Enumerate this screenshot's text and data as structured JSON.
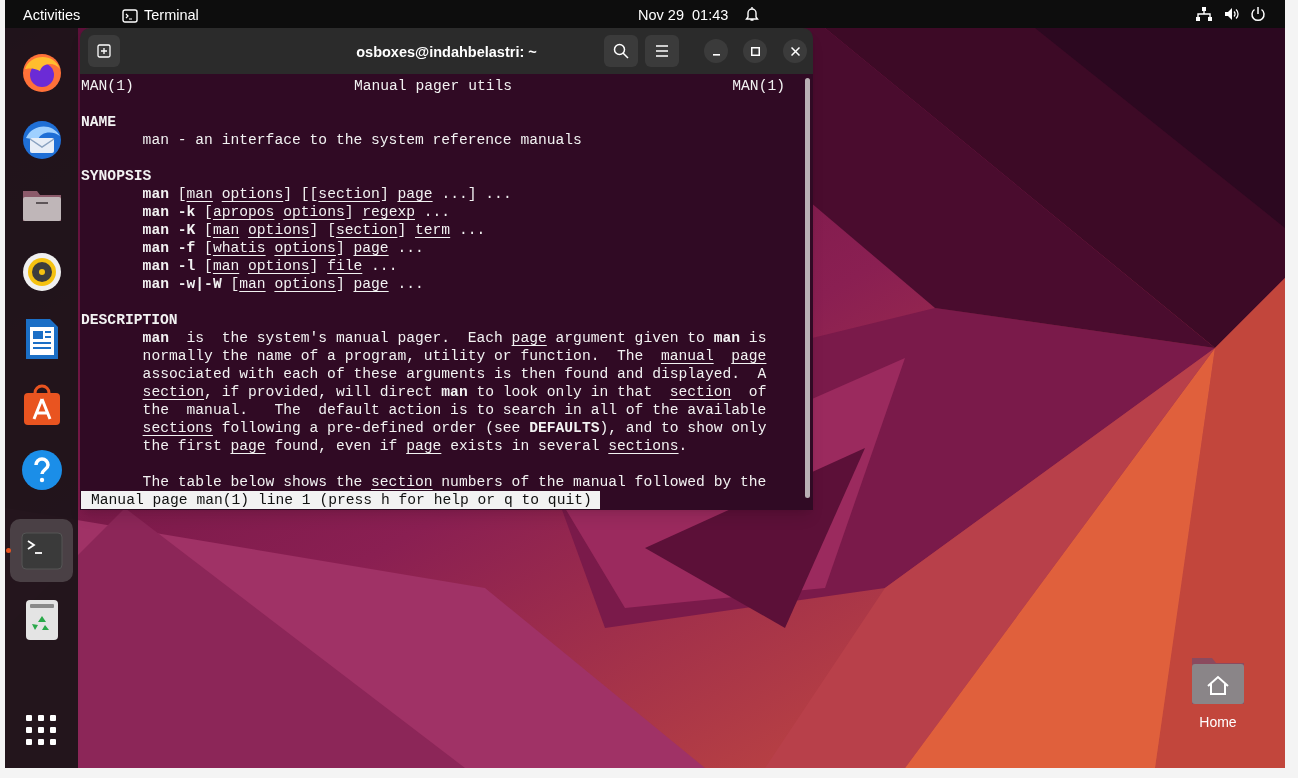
{
  "top_bar": {
    "activities": "Activities",
    "app": "Terminal",
    "clock": "Nov 29  01:43"
  },
  "dock": {
    "items": [
      {
        "kind": "firefox",
        "selected": false
      },
      {
        "kind": "thunderbird",
        "selected": false
      },
      {
        "kind": "files",
        "selected": false
      },
      {
        "kind": "rhythmbox",
        "selected": false
      },
      {
        "kind": "writer",
        "selected": false
      },
      {
        "kind": "appcenter",
        "selected": false
      },
      {
        "kind": "help",
        "selected": false
      },
      {
        "kind": "terminal",
        "selected": true
      },
      {
        "kind": "trash",
        "selected": false
      }
    ]
  },
  "window": {
    "title": "osboxes@indahbelastri: ~"
  },
  "man_page": {
    "header": {
      "left": "MAN(1)",
      "center": "Manual pager utils",
      "right": "MAN(1)"
    },
    "sections": [
      {
        "heading": "NAME",
        "paragraphs": [
          [
            "man - an interface to the system reference manuals"
          ]
        ]
      },
      {
        "heading": "SYNOPSIS",
        "paragraphs": [
          [
            "**man** [*man* *options*] [[*section*] *page* ...] ...",
            "**man -k** [*apropos* *options*] *regexp* ...",
            "**man -K** [*man* *options*] [*section*] *term* ...",
            "**man -f** [*whatis* *options*] *page* ...",
            "**man -l** [*man* *options*] *file* ...",
            "**man -w|-W** [*man* *options*] *page* ..."
          ]
        ]
      },
      {
        "heading": "DESCRIPTION",
        "paragraphs": [
          [
            "**man**  is  the system's manual pager.  Each *page* argument given to **man** is",
            "normally the name of a program, utility or function.  The  *manual*  *page*",
            "associated with each of these arguments is then found and displayed.  A",
            "*section*, if provided, will direct **man** to look only in that  *section*  of",
            "the  manual.   The  default action is to search in all of the available",
            "*sections* following a pre-defined order (see **DEFAULTS**), and to show only",
            "the first *page* found, even if *page* exists in several *sections*."
          ],
          [
            "The table below shows the *section* numbers of the manual followed by the"
          ]
        ]
      }
    ],
    "status": "Manual page man(1) line 1 (press h for help or q to quit)"
  },
  "desktop": {
    "icons": [
      {
        "label": "Home"
      }
    ]
  }
}
